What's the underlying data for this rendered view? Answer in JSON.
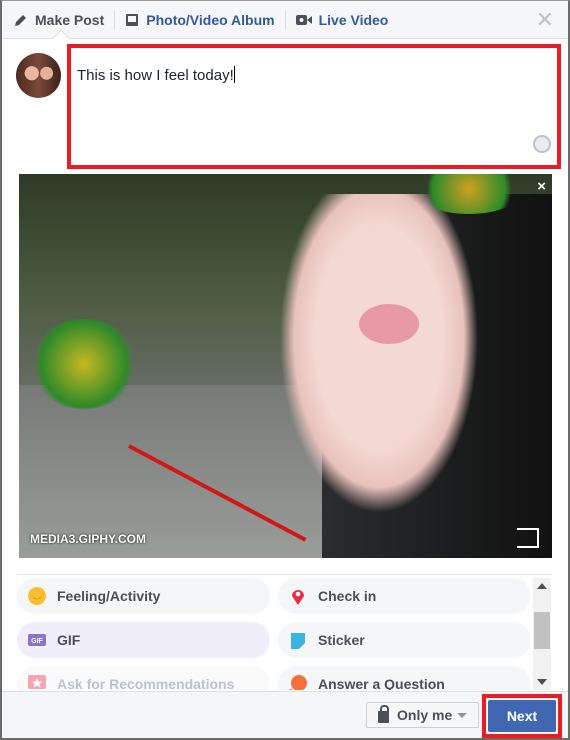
{
  "header": {
    "tabs": [
      {
        "label": "Make Post",
        "icon": "pencil-icon",
        "active": true
      },
      {
        "label": "Photo/Video Album",
        "icon": "photo-album-icon"
      },
      {
        "label": "Live Video",
        "icon": "video-camera-icon"
      }
    ],
    "close_icon": "close-icon"
  },
  "composer": {
    "text": "This is how I feel today!",
    "emoji_icon": "smiley-icon"
  },
  "media": {
    "credit": "MEDIA3.GIPHY.COM",
    "close_label": "×"
  },
  "options": [
    {
      "label": "Feeling/Activity",
      "icon": "smiley-icon",
      "color": "#f7c033"
    },
    {
      "label": "Check in",
      "icon": "location-pin-icon",
      "color": "#f02849"
    },
    {
      "label": "GIF",
      "icon": "gif-icon",
      "color": "#8c72cb"
    },
    {
      "label": "Sticker",
      "icon": "sticker-icon",
      "color": "#3ab5e0"
    },
    {
      "label": "Ask for Recommendations",
      "icon": "recommendation-star-icon",
      "color": "#f7a5b0"
    },
    {
      "label": "Answer a Question",
      "icon": "question-bubble-icon",
      "color": "#f5703c"
    }
  ],
  "footer": {
    "privacy_label": "Only me",
    "next_label": "Next"
  },
  "colors": {
    "accent": "#4267b2",
    "highlight": "#ec1c24"
  }
}
